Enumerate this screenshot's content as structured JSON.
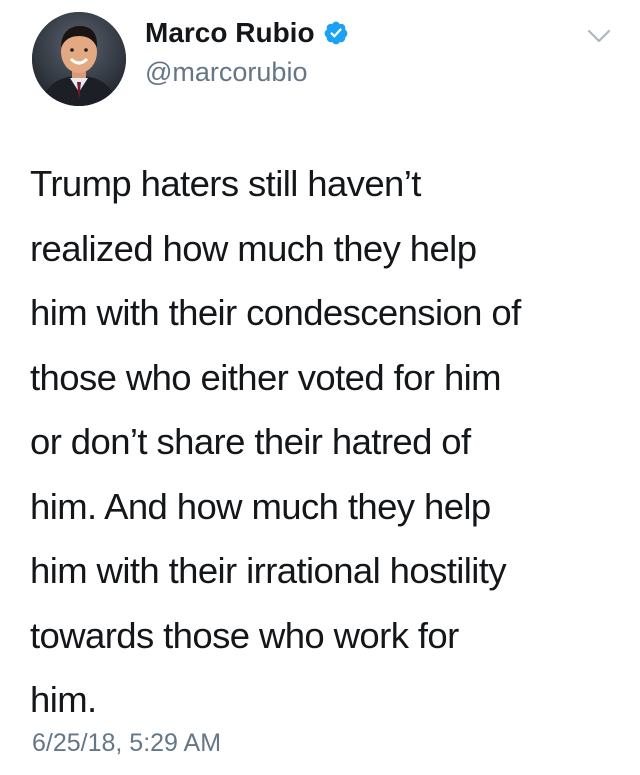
{
  "tweet": {
    "author": {
      "display_name": "Marco Rubio",
      "handle": "@marcorubio",
      "verified": true,
      "avatar_icon": "profile-photo",
      "verified_icon": "verified-badge-icon"
    },
    "menu_icon": "chevron-down-icon",
    "text_lines": [
      "Trump haters still haven’t",
      "realized how much they help",
      "him with their condescension of",
      "those who either voted for him",
      "or don’t share their hatred of",
      "him. And how much they help",
      "him with their irrational hostility",
      "towards those who work for",
      "him."
    ],
    "timestamp": "6/25/18, 5:29 AM"
  },
  "colors": {
    "text_primary": "#14171a",
    "text_secondary": "#657786",
    "verified_blue": "#1da1f2",
    "chevron": "#aab8c2",
    "background": "#ffffff"
  }
}
